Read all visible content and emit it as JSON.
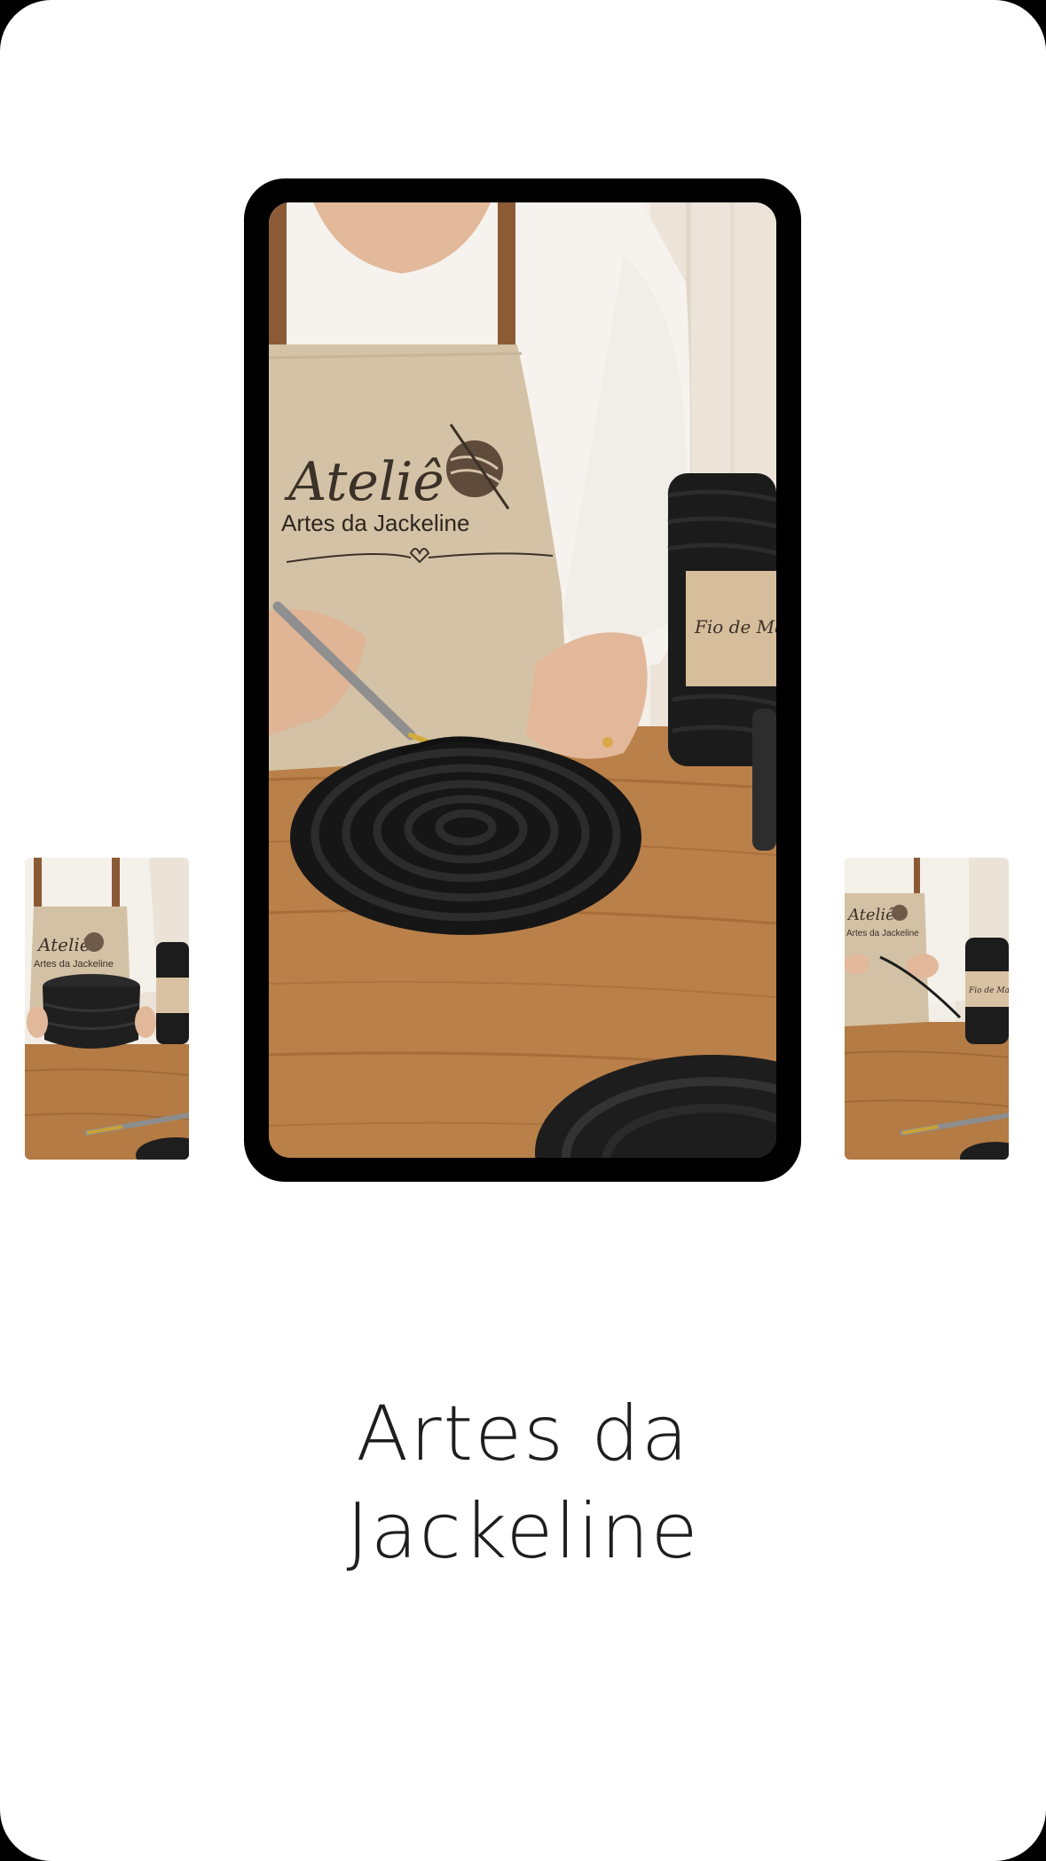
{
  "brand": {
    "line1": "Artes da",
    "line2": "Jackeline"
  },
  "slides": {
    "main": {
      "apron_logo_script": "Ateliê",
      "apron_logo_name": "Artes da Jackeline",
      "yarn_label": "Fio de Malha"
    },
    "left_preview": {
      "apron_logo_script": "Ateliê",
      "apron_logo_name": "Artes da Jackeline"
    },
    "right_preview": {
      "apron_logo_script": "Ateliê",
      "apron_logo_name": "Artes da Jackeline",
      "yarn_label": "Fio de Malha"
    }
  },
  "colors": {
    "background": "#ffffff",
    "frame": "#000000",
    "table_wood": "#b9814a",
    "apron": "#d2bfa3",
    "shirt": "#f3efe9",
    "yarn": "#1c1c1c",
    "text": "#1e1e1e"
  }
}
